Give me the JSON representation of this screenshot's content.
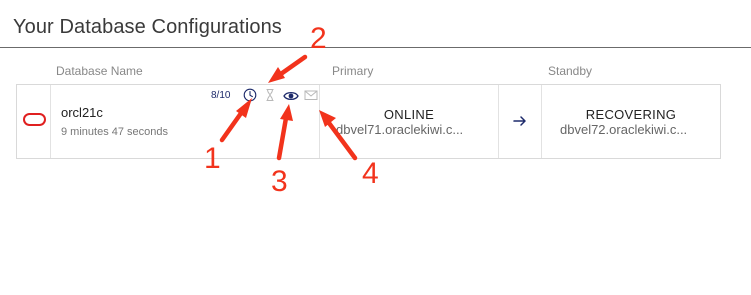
{
  "page": {
    "title": "Your Database Configurations"
  },
  "table": {
    "headers": {
      "database_name": "Database Name",
      "primary": "Primary",
      "standby": "Standby"
    },
    "rows": [
      {
        "name": "orcl21c",
        "elapsed": "9 minutes 47 seconds",
        "count": "8/10",
        "icons": [
          "oracle-logo",
          "clock-icon",
          "hourglass-icon",
          "eye-icon",
          "mail-icon",
          "arrow-right-icon"
        ],
        "primary": {
          "status": "ONLINE",
          "host": "dbvel71.oraclekiwi.c..."
        },
        "standby": {
          "status": "RECOVERING",
          "host": "dbvel72.oraclekiwi.c..."
        }
      }
    ]
  },
  "annotations": {
    "labels": [
      "1",
      "2",
      "3",
      "4"
    ],
    "color": "#f2331c"
  },
  "colors": {
    "oracle_red": "#e02020",
    "icon_navy": "#1d2a6b",
    "icon_gray": "#b8b8b8"
  }
}
